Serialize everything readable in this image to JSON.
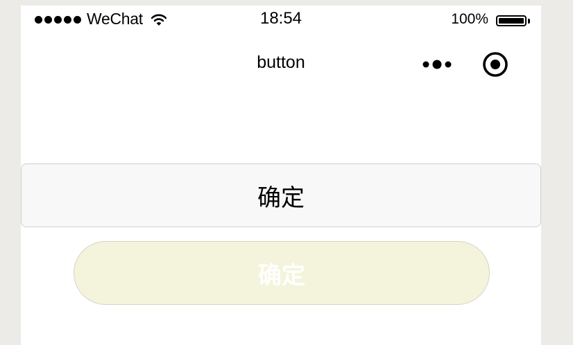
{
  "status_bar": {
    "carrier": "WeChat",
    "time": "18:54",
    "battery_percent": "100%",
    "battery_level": 1.0,
    "signal_bars": 5
  },
  "nav_bar": {
    "title": "button",
    "more_icon": "more-dots-icon",
    "close_icon": "capsule-close-icon"
  },
  "buttons": {
    "default_label": "确定",
    "disabled_label": "确定"
  },
  "colors": {
    "page_bg": "#ecebe7",
    "screen_bg": "#ffffff",
    "default_button_bg": "#f8f8f8",
    "disabled_button_bg": "#f4f4dc"
  }
}
